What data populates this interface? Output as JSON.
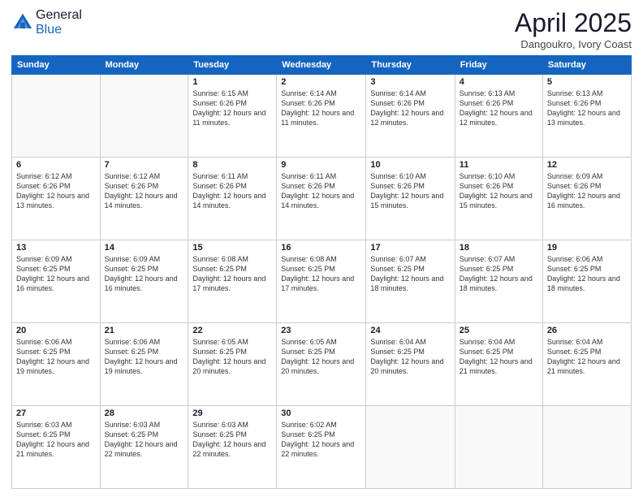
{
  "header": {
    "logo_general": "General",
    "logo_blue": "Blue",
    "month_title": "April 2025",
    "location": "Dangoukro, Ivory Coast"
  },
  "days_of_week": [
    "Sunday",
    "Monday",
    "Tuesday",
    "Wednesday",
    "Thursday",
    "Friday",
    "Saturday"
  ],
  "weeks": [
    [
      {
        "day": "",
        "info": ""
      },
      {
        "day": "",
        "info": ""
      },
      {
        "day": "1",
        "info": "Sunrise: 6:15 AM\nSunset: 6:26 PM\nDaylight: 12 hours and 11 minutes."
      },
      {
        "day": "2",
        "info": "Sunrise: 6:14 AM\nSunset: 6:26 PM\nDaylight: 12 hours and 11 minutes."
      },
      {
        "day": "3",
        "info": "Sunrise: 6:14 AM\nSunset: 6:26 PM\nDaylight: 12 hours and 12 minutes."
      },
      {
        "day": "4",
        "info": "Sunrise: 6:13 AM\nSunset: 6:26 PM\nDaylight: 12 hours and 12 minutes."
      },
      {
        "day": "5",
        "info": "Sunrise: 6:13 AM\nSunset: 6:26 PM\nDaylight: 12 hours and 13 minutes."
      }
    ],
    [
      {
        "day": "6",
        "info": "Sunrise: 6:12 AM\nSunset: 6:26 PM\nDaylight: 12 hours and 13 minutes."
      },
      {
        "day": "7",
        "info": "Sunrise: 6:12 AM\nSunset: 6:26 PM\nDaylight: 12 hours and 14 minutes."
      },
      {
        "day": "8",
        "info": "Sunrise: 6:11 AM\nSunset: 6:26 PM\nDaylight: 12 hours and 14 minutes."
      },
      {
        "day": "9",
        "info": "Sunrise: 6:11 AM\nSunset: 6:26 PM\nDaylight: 12 hours and 14 minutes."
      },
      {
        "day": "10",
        "info": "Sunrise: 6:10 AM\nSunset: 6:26 PM\nDaylight: 12 hours and 15 minutes."
      },
      {
        "day": "11",
        "info": "Sunrise: 6:10 AM\nSunset: 6:26 PM\nDaylight: 12 hours and 15 minutes."
      },
      {
        "day": "12",
        "info": "Sunrise: 6:09 AM\nSunset: 6:26 PM\nDaylight: 12 hours and 16 minutes."
      }
    ],
    [
      {
        "day": "13",
        "info": "Sunrise: 6:09 AM\nSunset: 6:25 PM\nDaylight: 12 hours and 16 minutes."
      },
      {
        "day": "14",
        "info": "Sunrise: 6:09 AM\nSunset: 6:25 PM\nDaylight: 12 hours and 16 minutes."
      },
      {
        "day": "15",
        "info": "Sunrise: 6:08 AM\nSunset: 6:25 PM\nDaylight: 12 hours and 17 minutes."
      },
      {
        "day": "16",
        "info": "Sunrise: 6:08 AM\nSunset: 6:25 PM\nDaylight: 12 hours and 17 minutes."
      },
      {
        "day": "17",
        "info": "Sunrise: 6:07 AM\nSunset: 6:25 PM\nDaylight: 12 hours and 18 minutes."
      },
      {
        "day": "18",
        "info": "Sunrise: 6:07 AM\nSunset: 6:25 PM\nDaylight: 12 hours and 18 minutes."
      },
      {
        "day": "19",
        "info": "Sunrise: 6:06 AM\nSunset: 6:25 PM\nDaylight: 12 hours and 18 minutes."
      }
    ],
    [
      {
        "day": "20",
        "info": "Sunrise: 6:06 AM\nSunset: 6:25 PM\nDaylight: 12 hours and 19 minutes."
      },
      {
        "day": "21",
        "info": "Sunrise: 6:06 AM\nSunset: 6:25 PM\nDaylight: 12 hours and 19 minutes."
      },
      {
        "day": "22",
        "info": "Sunrise: 6:05 AM\nSunset: 6:25 PM\nDaylight: 12 hours and 20 minutes."
      },
      {
        "day": "23",
        "info": "Sunrise: 6:05 AM\nSunset: 6:25 PM\nDaylight: 12 hours and 20 minutes."
      },
      {
        "day": "24",
        "info": "Sunrise: 6:04 AM\nSunset: 6:25 PM\nDaylight: 12 hours and 20 minutes."
      },
      {
        "day": "25",
        "info": "Sunrise: 6:04 AM\nSunset: 6:25 PM\nDaylight: 12 hours and 21 minutes."
      },
      {
        "day": "26",
        "info": "Sunrise: 6:04 AM\nSunset: 6:25 PM\nDaylight: 12 hours and 21 minutes."
      }
    ],
    [
      {
        "day": "27",
        "info": "Sunrise: 6:03 AM\nSunset: 6:25 PM\nDaylight: 12 hours and 21 minutes."
      },
      {
        "day": "28",
        "info": "Sunrise: 6:03 AM\nSunset: 6:25 PM\nDaylight: 12 hours and 22 minutes."
      },
      {
        "day": "29",
        "info": "Sunrise: 6:03 AM\nSunset: 6:25 PM\nDaylight: 12 hours and 22 minutes."
      },
      {
        "day": "30",
        "info": "Sunrise: 6:02 AM\nSunset: 6:25 PM\nDaylight: 12 hours and 22 minutes."
      },
      {
        "day": "",
        "info": ""
      },
      {
        "day": "",
        "info": ""
      },
      {
        "day": "",
        "info": ""
      }
    ]
  ]
}
